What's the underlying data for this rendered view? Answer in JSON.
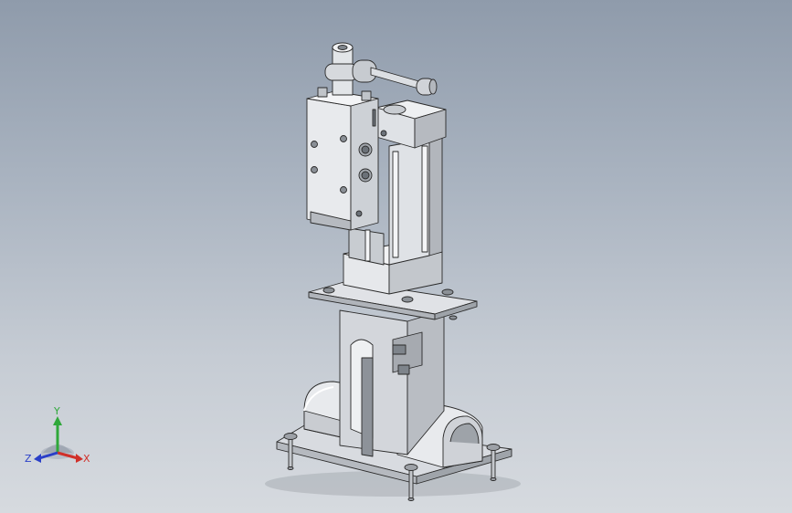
{
  "viewport": {
    "background_top": "#8f9bab",
    "background_bottom": "#d6dadf"
  },
  "model": {
    "icon": "pneumatic-cylinder-assembly-icon",
    "body_color": "#e4e6ea",
    "shadow_color": "#a8acb2",
    "edge_color": "#2a2a2a"
  },
  "triad": {
    "x_label": "X",
    "y_label": "Y",
    "z_label": "Z",
    "x_color": "#d0302a",
    "y_color": "#2fa83a",
    "z_color": "#2a3fc8"
  }
}
